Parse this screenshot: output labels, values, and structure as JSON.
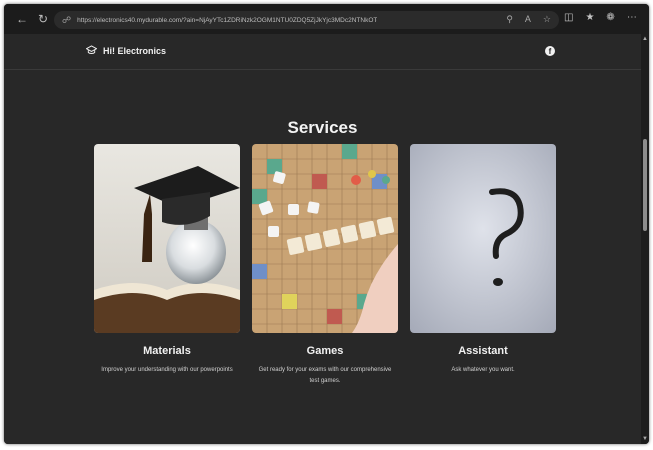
{
  "browser": {
    "url": "https://electronics40.mydurable.com/?ain=NjAyYTc1ZDRiNzk2OGM1NTU0ZDQ5ZjJkYjc3MDc2NTNkOTc0NjFkN2dlNw",
    "back_icon": "arrow-left-icon",
    "refresh_icon": "refresh-icon"
  },
  "site": {
    "brand_name": "Hi! Electronics",
    "brand_icon": "graduation-cap-icon",
    "social_icon": "facebook-icon"
  },
  "services": {
    "title": "Services",
    "cards": [
      {
        "title": "Materials",
        "description": "Improve your understanding with our powerpoints"
      },
      {
        "title": "Games",
        "description": "Get ready for your exams with our comprehensive test games."
      },
      {
        "title": "Assistant",
        "description": "Ask whatever you want."
      }
    ]
  },
  "colors": {
    "page_bg": "#282828",
    "browser_bar": "#1c1c1c",
    "text": "#f1f1f1"
  }
}
